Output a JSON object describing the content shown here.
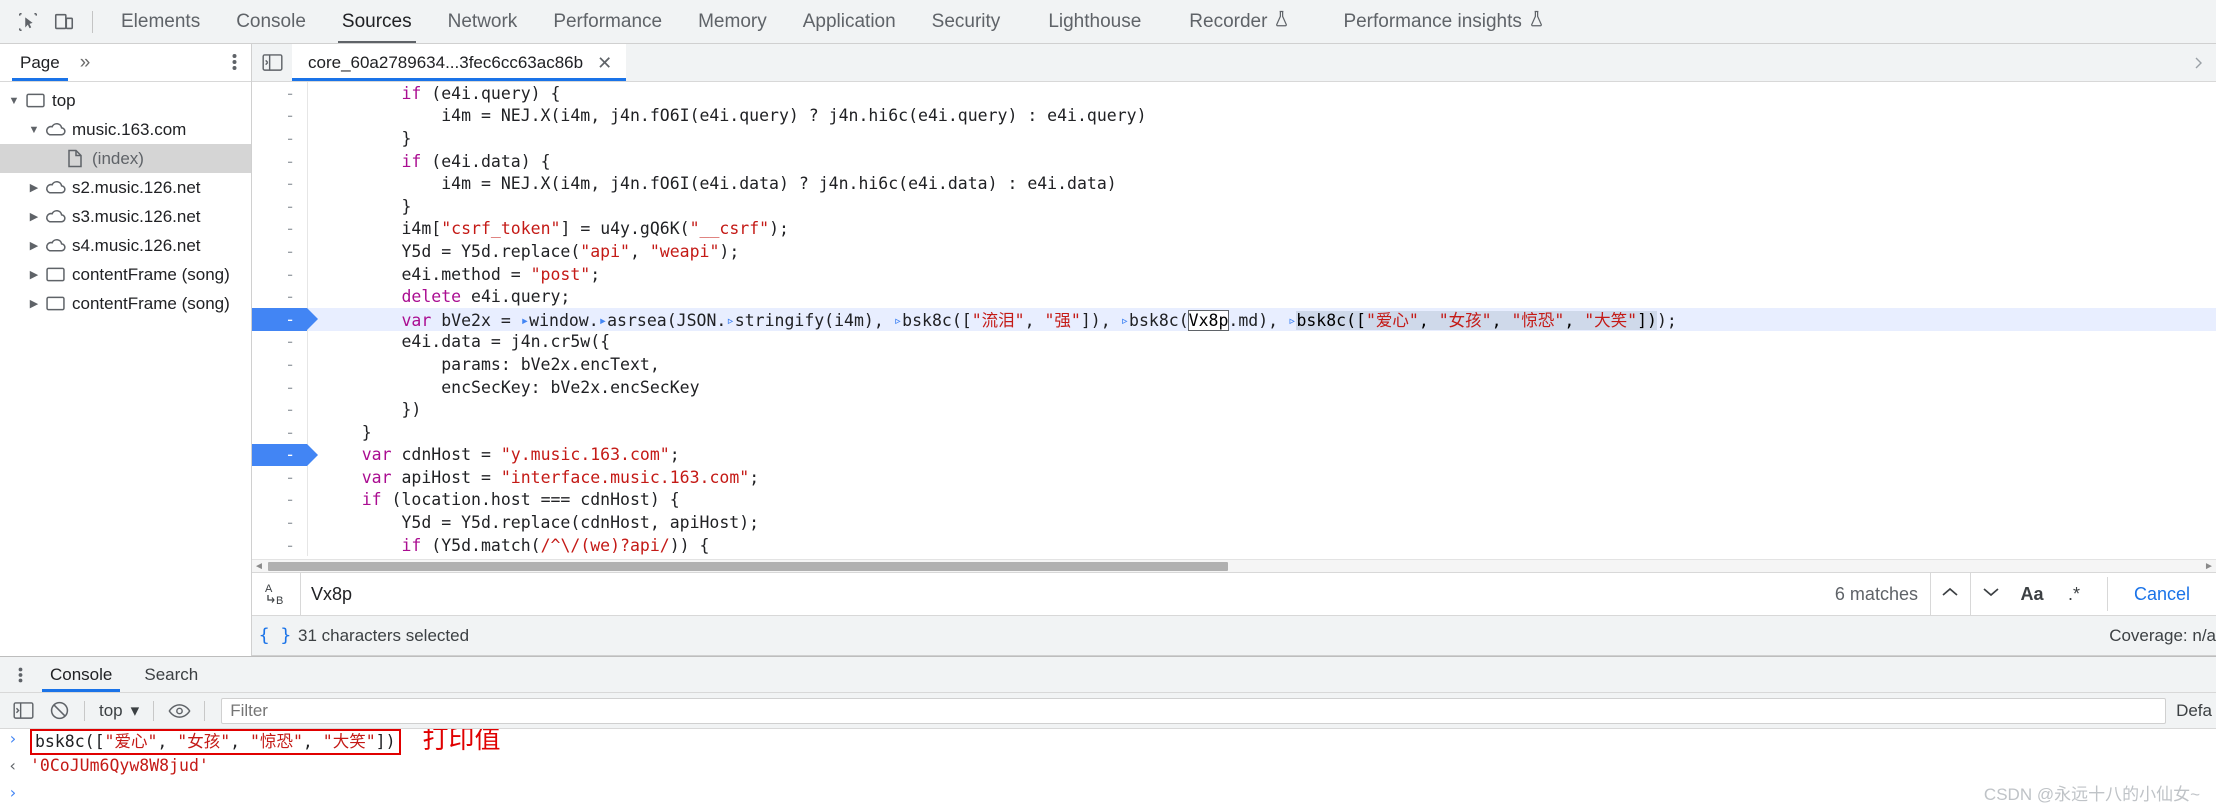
{
  "devtools": {
    "toolbar": {
      "inspect_icon": "inspect-element-icon",
      "device_icon": "device-toolbar-icon",
      "tabs": [
        {
          "label": "Elements",
          "selected": false,
          "experimental": false
        },
        {
          "label": "Console",
          "selected": false,
          "experimental": false
        },
        {
          "label": "Sources",
          "selected": true,
          "experimental": false
        },
        {
          "label": "Network",
          "selected": false,
          "experimental": false
        },
        {
          "label": "Performance",
          "selected": false,
          "experimental": false
        },
        {
          "label": "Memory",
          "selected": false,
          "experimental": false
        },
        {
          "label": "Application",
          "selected": false,
          "experimental": false
        },
        {
          "label": "Security",
          "selected": false,
          "experimental": false
        },
        {
          "label": "Lighthouse",
          "selected": false,
          "experimental": false
        },
        {
          "label": "Recorder",
          "selected": false,
          "experimental": true
        },
        {
          "label": "Performance insights",
          "selected": false,
          "experimental": true
        }
      ]
    }
  },
  "navigator": {
    "tab_label": "Page",
    "more_tabs_label": "»",
    "dots_icon": "more-options-icon",
    "tree": [
      {
        "label": "top",
        "icon": "frame-icon",
        "depth": 0,
        "twisty": "down",
        "selected": false
      },
      {
        "label": "music.163.com",
        "icon": "cloud-icon",
        "depth": 1,
        "twisty": "down",
        "selected": false
      },
      {
        "label": "(index)",
        "icon": "document-icon",
        "depth": 2,
        "twisty": "none",
        "selected": true
      },
      {
        "label": "s2.music.126.net",
        "icon": "cloud-icon",
        "depth": 1,
        "twisty": "right",
        "selected": false
      },
      {
        "label": "s3.music.126.net",
        "icon": "cloud-icon",
        "depth": 1,
        "twisty": "right",
        "selected": false
      },
      {
        "label": "s4.music.126.net",
        "icon": "cloud-icon",
        "depth": 1,
        "twisty": "right",
        "selected": false
      },
      {
        "label": "contentFrame (song)",
        "icon": "frame-icon",
        "depth": 1,
        "twisty": "right",
        "selected": false
      },
      {
        "label": "contentFrame (song)",
        "icon": "frame-icon",
        "depth": 1,
        "twisty": "right",
        "selected": false
      }
    ]
  },
  "editor": {
    "panel_toggle_icon": "show-navigator-icon",
    "file_tab": {
      "label": "core_60a2789634...3fec6cc63ac86b",
      "close_icon": "close-icon"
    },
    "lines": [
      {
        "gutter": "-",
        "breakpoint": false,
        "highlight": false,
        "indent": 8,
        "segments": [
          {
            "t": "if",
            "c": "k"
          },
          {
            "t": " (e4i.query) {",
            "c": "pl"
          }
        ]
      },
      {
        "gutter": "-",
        "breakpoint": false,
        "highlight": false,
        "indent": 12,
        "segments": [
          {
            "t": "i4m = NEJ.X(i4m, j4n.fO6I(e4i.query) ? j4n.hi6c(e4i.query) : e4i.query)",
            "c": "pl"
          }
        ]
      },
      {
        "gutter": "-",
        "breakpoint": false,
        "highlight": false,
        "indent": 8,
        "segments": [
          {
            "t": "}",
            "c": "pl"
          }
        ]
      },
      {
        "gutter": "-",
        "breakpoint": false,
        "highlight": false,
        "indent": 8,
        "segments": [
          {
            "t": "if",
            "c": "k"
          },
          {
            "t": " (e4i.data) {",
            "c": "pl"
          }
        ]
      },
      {
        "gutter": "-",
        "breakpoint": false,
        "highlight": false,
        "indent": 12,
        "segments": [
          {
            "t": "i4m = NEJ.X(i4m, j4n.fO6I(e4i.data) ? j4n.hi6c(e4i.data) : e4i.data)",
            "c": "pl"
          }
        ]
      },
      {
        "gutter": "-",
        "breakpoint": false,
        "highlight": false,
        "indent": 8,
        "segments": [
          {
            "t": "}",
            "c": "pl"
          }
        ]
      },
      {
        "gutter": "-",
        "breakpoint": false,
        "highlight": false,
        "indent": 8,
        "segments": [
          {
            "t": "i4m[",
            "c": "pl"
          },
          {
            "t": "\"csrf_token\"",
            "c": "str"
          },
          {
            "t": "] = u4y.gQ6K(",
            "c": "pl"
          },
          {
            "t": "\"__csrf\"",
            "c": "str"
          },
          {
            "t": ");",
            "c": "pl"
          }
        ]
      },
      {
        "gutter": "-",
        "breakpoint": false,
        "highlight": false,
        "indent": 8,
        "segments": [
          {
            "t": "Y5d = Y5d.replace(",
            "c": "pl"
          },
          {
            "t": "\"api\"",
            "c": "str"
          },
          {
            "t": ", ",
            "c": "pl"
          },
          {
            "t": "\"weapi\"",
            "c": "str"
          },
          {
            "t": ");",
            "c": "pl"
          }
        ]
      },
      {
        "gutter": "-",
        "breakpoint": false,
        "highlight": false,
        "indent": 8,
        "segments": [
          {
            "t": "e4i.method = ",
            "c": "pl"
          },
          {
            "t": "\"post\"",
            "c": "str"
          },
          {
            "t": ";",
            "c": "pl"
          }
        ]
      },
      {
        "gutter": "-",
        "breakpoint": false,
        "highlight": false,
        "indent": 8,
        "segments": [
          {
            "t": "delete",
            "c": "k"
          },
          {
            "t": " e4i.query;",
            "c": "pl"
          }
        ]
      },
      {
        "gutter": "-",
        "breakpoint": true,
        "highlight": true,
        "indent": 8,
        "segments": [
          {
            "t": "var",
            "c": "k"
          },
          {
            "t": " bVe2x = ",
            "c": "pl"
          },
          {
            "t": "▸",
            "c": "fold"
          },
          {
            "t": "window.",
            "c": "pl"
          },
          {
            "t": "▸",
            "c": "fold"
          },
          {
            "t": "asrsea(JSON.",
            "c": "pl"
          },
          {
            "t": "▹",
            "c": "fold"
          },
          {
            "t": "stringify(i4m), ",
            "c": "pl"
          },
          {
            "t": "▹",
            "c": "fold"
          },
          {
            "t": "bsk8c([",
            "c": "pl"
          },
          {
            "t": "\"流泪\"",
            "c": "str"
          },
          {
            "t": ", ",
            "c": "pl"
          },
          {
            "t": "\"强\"",
            "c": "str"
          },
          {
            "t": "]), ",
            "c": "pl"
          },
          {
            "t": "▹",
            "c": "fold"
          },
          {
            "t": "bsk8c(",
            "c": "pl"
          },
          {
            "t": "Vx8p",
            "c": "srch-box"
          },
          {
            "t": ".md), ",
            "c": "pl"
          },
          {
            "t": "▹",
            "c": "fold"
          },
          {
            "t": "bsk8c([",
            "c": "sel-hl"
          },
          {
            "t": "\"爱心\"",
            "c": "str sel-hl"
          },
          {
            "t": ", ",
            "c": "sel-hl"
          },
          {
            "t": "\"女孩\"",
            "c": "str sel-hl"
          },
          {
            "t": ", ",
            "c": "sel-hl"
          },
          {
            "t": "\"惊恐\"",
            "c": "str sel-hl"
          },
          {
            "t": ", ",
            "c": "sel-hl"
          },
          {
            "t": "\"大笑\"",
            "c": "str sel-hl"
          },
          {
            "t": "])",
            "c": "sel-hl"
          },
          {
            "t": ");",
            "c": "pl"
          }
        ]
      },
      {
        "gutter": "-",
        "breakpoint": false,
        "highlight": false,
        "indent": 8,
        "segments": [
          {
            "t": "e4i.data = j4n.cr5w({",
            "c": "pl"
          }
        ]
      },
      {
        "gutter": "-",
        "breakpoint": false,
        "highlight": false,
        "indent": 12,
        "segments": [
          {
            "t": "params: bVe2x.encText,",
            "c": "pl"
          }
        ]
      },
      {
        "gutter": "-",
        "breakpoint": false,
        "highlight": false,
        "indent": 12,
        "segments": [
          {
            "t": "encSecKey: bVe2x.encSecKey",
            "c": "pl"
          }
        ]
      },
      {
        "gutter": "-",
        "breakpoint": false,
        "highlight": false,
        "indent": 8,
        "segments": [
          {
            "t": "})",
            "c": "pl"
          }
        ]
      },
      {
        "gutter": "-",
        "breakpoint": false,
        "highlight": false,
        "indent": 4,
        "segments": [
          {
            "t": "}",
            "c": "pl"
          }
        ]
      },
      {
        "gutter": "-",
        "breakpoint": true,
        "highlight": false,
        "indent": 4,
        "segments": [
          {
            "t": "var",
            "c": "k"
          },
          {
            "t": " cdnHost = ",
            "c": "pl"
          },
          {
            "t": "\"y.music.163.com\"",
            "c": "str"
          },
          {
            "t": ";",
            "c": "pl"
          }
        ]
      },
      {
        "gutter": "-",
        "breakpoint": false,
        "highlight": false,
        "indent": 4,
        "segments": [
          {
            "t": "var",
            "c": "k"
          },
          {
            "t": " apiHost = ",
            "c": "pl"
          },
          {
            "t": "\"interface.music.163.com\"",
            "c": "str"
          },
          {
            "t": ";",
            "c": "pl"
          }
        ]
      },
      {
        "gutter": "-",
        "breakpoint": false,
        "highlight": false,
        "indent": 4,
        "segments": [
          {
            "t": "if",
            "c": "k"
          },
          {
            "t": " (location.host === cdnHost) {",
            "c": "pl"
          }
        ]
      },
      {
        "gutter": "-",
        "breakpoint": false,
        "highlight": false,
        "indent": 8,
        "segments": [
          {
            "t": "Y5d = Y5d.replace(cdnHost, apiHost);",
            "c": "pl"
          }
        ]
      },
      {
        "gutter": "-",
        "breakpoint": false,
        "highlight": false,
        "indent": 8,
        "segments": [
          {
            "t": "if",
            "c": "k"
          },
          {
            "t": " (Y5d.match(",
            "c": "pl"
          },
          {
            "t": "/^\\/(we)?api/",
            "c": "rx"
          },
          {
            "t": ")) {",
            "c": "pl"
          }
        ]
      }
    ]
  },
  "search": {
    "replace_icon": "replace-ab-icon",
    "value": "Vx8p",
    "placeholder": "",
    "matches_label": "6 matches",
    "prev_icon": "chevron-up-icon",
    "next_icon": "chevron-down-icon",
    "match_case_label": "Aa",
    "regex_label": ".*",
    "cancel_label": "Cancel"
  },
  "status": {
    "pretty_print_icon": "curly-braces-icon",
    "selection_label": "31 characters selected",
    "coverage_label": "Coverage: n/a"
  },
  "drawer": {
    "more_icon": "more-options-icon",
    "tabs": [
      {
        "label": "Console",
        "selected": true
      },
      {
        "label": "Search",
        "selected": false
      }
    ],
    "tools": {
      "sidebar_icon": "console-sidebar-icon",
      "clear_icon": "clear-console-icon",
      "context_label": "top",
      "context_caret": "▾",
      "eye_icon": "live-expression-icon",
      "filter_placeholder": "Filter",
      "levels_label": "Defa"
    },
    "console": [
      {
        "kind": "input",
        "prompt": "›",
        "boxed": true,
        "annotation": "打印值",
        "segments": [
          {
            "t": "bsk8c([",
            "c": "cfn"
          },
          {
            "t": "\"爱心\"",
            "c": "cstr"
          },
          {
            "t": ", ",
            "c": "cfn"
          },
          {
            "t": "\"女孩\"",
            "c": "cstr"
          },
          {
            "t": ", ",
            "c": "cfn"
          },
          {
            "t": "\"惊恐\"",
            "c": "cstr"
          },
          {
            "t": ", ",
            "c": "cfn"
          },
          {
            "t": "\"大笑\"",
            "c": "cstr"
          },
          {
            "t": "])",
            "c": "cfn"
          }
        ]
      },
      {
        "kind": "output",
        "prompt": "‹",
        "boxed": false,
        "annotation": "",
        "segments": [
          {
            "t": "'0CoJUm6Qyw8W8jud'",
            "c": "cstr"
          }
        ]
      },
      {
        "kind": "prompt",
        "prompt": "›",
        "boxed": false,
        "annotation": "",
        "segments": []
      }
    ]
  },
  "watermark": "CSDN @永远十八的小仙女~"
}
